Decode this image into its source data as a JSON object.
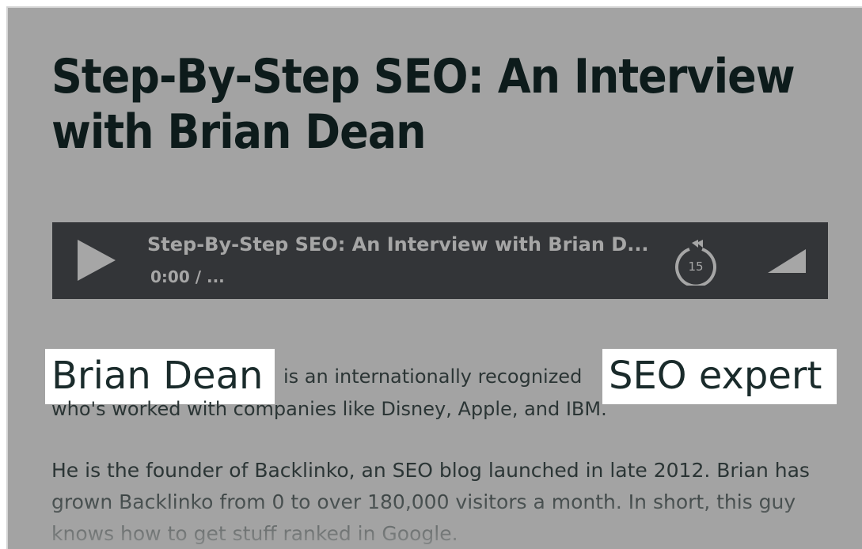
{
  "article": {
    "title": "Step-By-Step SEO: An Interview with Brian Dean",
    "intro_name": "Brian Dean",
    "intro_middle": "is an internationally recognized",
    "intro_expert": "SEO expert",
    "intro_line2": "who's worked with companies like Disney, Apple, and IBM.",
    "paragraph2": "He is the founder of Backlinko, an SEO blog launched in late 2012. Brian has grown Backlinko from 0 to over 180,000 visitors a month. In short, this guy knows how to get stuff ranked in Google."
  },
  "player": {
    "episode_title": "Step-By-Step SEO: An Interview with Brian D...",
    "time": "0:00 / ...",
    "rewind_seconds": "15",
    "play_icon": "play-icon",
    "rewind_icon": "rewind-15-icon",
    "volume_icon": "volume-icon",
    "colors": {
      "background": "#333538",
      "foreground": "#a6a6a6"
    }
  },
  "colors": {
    "page_background": "#a3a3a3",
    "title": "#0d1b1b",
    "highlight": "#ffffff"
  }
}
